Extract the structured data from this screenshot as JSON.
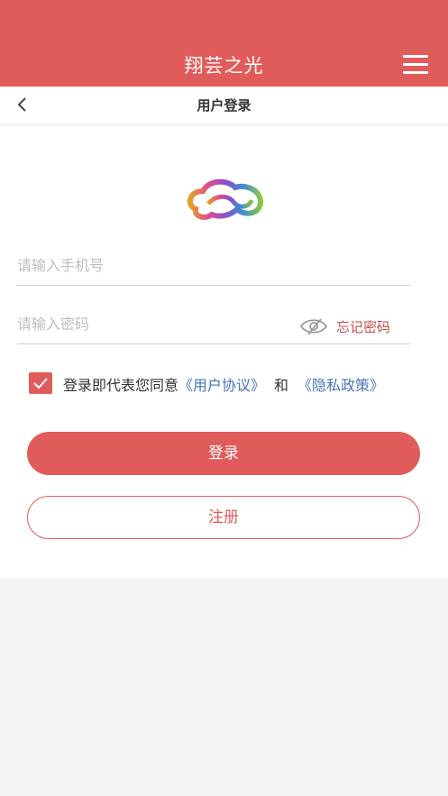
{
  "header": {
    "title": "翔芸之光"
  },
  "subbar": {
    "title": "用户登录"
  },
  "form": {
    "phone_placeholder": "请输入手机号",
    "password_placeholder": "请输入密码",
    "forgot_password": "忘记密码",
    "agreement_prefix": "登录即代表您同意",
    "user_agreement": "《用户协议》",
    "connector": "和",
    "privacy_policy": "《隐私政策》",
    "agreement_checked": true
  },
  "buttons": {
    "login": "登录",
    "register": "注册"
  },
  "colors": {
    "brand": "#e05c5a",
    "link": "#4a73b8"
  },
  "icons": [
    "menu-icon",
    "back-arrow-icon",
    "logo-cloud",
    "eye-hidden-icon",
    "check-icon"
  ]
}
